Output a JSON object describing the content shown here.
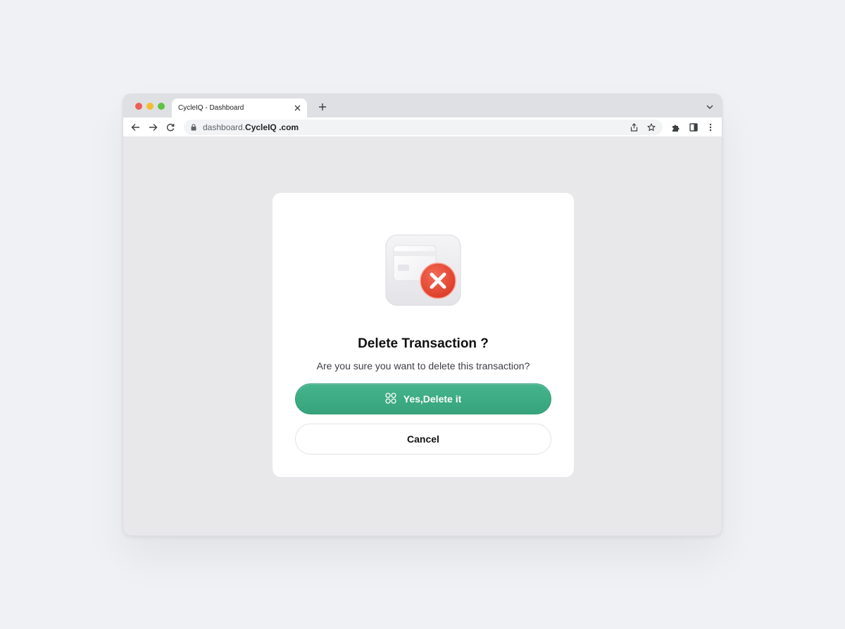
{
  "browser": {
    "tab_title": "CycleIQ  - Dashboard",
    "url_prefix": "dashboard.",
    "url_domain": "CycleIQ .com"
  },
  "dialog": {
    "title": "Delete Transaction ?",
    "message": "Are you sure you want to delete this transaction?",
    "confirm_label": "Yes,Delete it",
    "cancel_label": "Cancel",
    "illustration_icon": "card-delete-icon",
    "confirm_icon": "grid-dots-icon"
  },
  "colors": {
    "confirm_button": "#3aa981",
    "delete_badge": "#e8462f",
    "page_background": "#f0f1f4"
  }
}
